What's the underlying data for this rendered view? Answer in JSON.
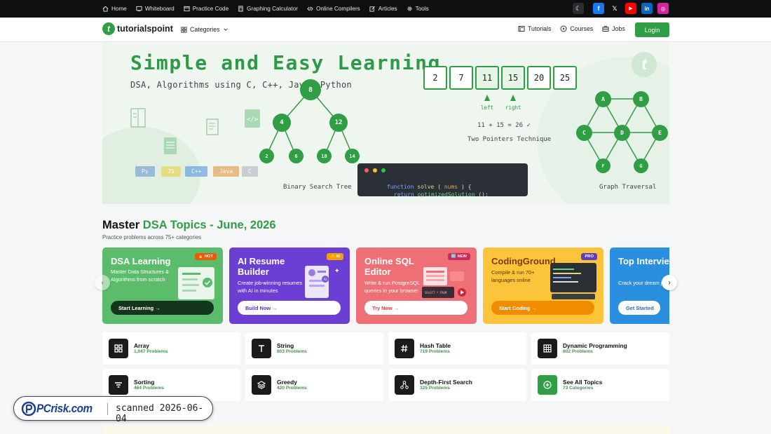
{
  "topnav": [
    {
      "label": "Home",
      "icon": "home-icon"
    },
    {
      "label": "Whiteboard",
      "icon": "whiteboard-icon"
    },
    {
      "label": "Practice Code",
      "icon": "code-window-icon"
    },
    {
      "label": "Graphing Calculator",
      "icon": "calculator-icon"
    },
    {
      "label": "Online Compilers",
      "icon": "code-brackets-icon"
    },
    {
      "label": "Articles",
      "icon": "pencil-icon"
    },
    {
      "label": "Tools",
      "icon": "gear-icon"
    }
  ],
  "header": {
    "logo_text": "tutorialspoint",
    "categories_label": "Categories",
    "links": [
      {
        "label": "Tutorials",
        "icon": "book-icon"
      },
      {
        "label": "Courses",
        "icon": "play-circle-icon"
      },
      {
        "label": "Jobs",
        "icon": "briefcase-icon"
      }
    ],
    "login_label": "Login"
  },
  "hero": {
    "title": "Simple and Easy Learning",
    "subtitle": "DSA, Algorithms using C, C++, Java, Python",
    "bst_nodes": [
      "8",
      "4",
      "12",
      "2",
      "6",
      "10",
      "14"
    ],
    "bst_caption": "Binary Search Tree",
    "langs": [
      "Py",
      "JS",
      "C++",
      "Java",
      "C"
    ],
    "array": [
      "2",
      "7",
      "11",
      "15",
      "20",
      "25"
    ],
    "left_label": "left",
    "right_label": "right",
    "sum_text": "11 + 15 = 26 ✓",
    "two_pointers_caption": "Two Pointers Technique",
    "graph_nodes": [
      "A",
      "B",
      "C",
      "D",
      "E",
      "F",
      "G"
    ],
    "graph_caption": "Graph Traversal",
    "code_line1": {
      "kw": "function",
      "fn": "solve",
      "open": "(",
      "arg": "nums",
      "close": ")",
      "brace": "{"
    },
    "code_line2": {
      "kw": "return",
      "fn": "optimizedSolution",
      "call": "();"
    }
  },
  "section": {
    "title_plain": "Master",
    "title_green": "DSA Topics - June, 2026",
    "subtitle": "Practice problems across 75+ categories"
  },
  "cards": [
    {
      "title": "DSA Learning",
      "desc": "Master Data Structures & Algorithms from scratch",
      "button": "Start Learning →",
      "badge": "🔥 HOT",
      "bg": "#5bbd6b",
      "btn_bg": "#14361d",
      "btn_color": "#ffffff",
      "badge_bg": "#e8590c"
    },
    {
      "title": "AI Resume Builder",
      "desc": "Create job-winning resumes with AI in minutes",
      "button": "Build Now →",
      "badge": "✨ AI",
      "bg": "#6b3fd4",
      "btn_bg": "#ffffff",
      "btn_color": "#5b2fc0",
      "badge_bg": "#f59f00"
    },
    {
      "title": "Online SQL Editor",
      "desc": "Write & run PostgreSQL queries in your browser",
      "button": "Try Now →",
      "badge": "🆕 NEW",
      "bg": "#ef6f77",
      "btn_bg": "#ffffff",
      "btn_color": "#e03a4a",
      "badge_bg": "#c92a5a"
    },
    {
      "title": "CodingGround",
      "desc": "Compile & run 70+ languages online",
      "button": "Start Coding →",
      "badge": "PRO",
      "bg": "#fcc43a",
      "btn_bg": "#f08c00",
      "btn_color": "#ffffff",
      "badge_bg": "#5f3dc4"
    },
    {
      "title": "Top Interview Questions",
      "desc": "Crack your dream job",
      "button": "Get Started",
      "badge": "",
      "bg": "#2b8fe0",
      "btn_bg": "#ffffff",
      "btn_color": "#1c6fc2",
      "badge_bg": "#2b8fe0"
    }
  ],
  "topics": [
    {
      "name": "Array",
      "count": "1,047 Problems",
      "icon": "grid-icon"
    },
    {
      "name": "String",
      "count": "803 Problems",
      "icon": "text-t-icon"
    },
    {
      "name": "Hash Table",
      "count": "719 Problems",
      "icon": "hash-icon"
    },
    {
      "name": "Dynamic Programming",
      "count": "602 Problems",
      "icon": "table-icon"
    },
    {
      "name": "Sorting",
      "count": "464 Problems",
      "icon": "sort-lines-icon"
    },
    {
      "name": "Greedy",
      "count": "420 Problems",
      "icon": "layers-icon"
    },
    {
      "name": "Depth-First Search",
      "count": "325 Problems",
      "icon": "graph-nodes-icon"
    },
    {
      "name": "See All Topics",
      "count": "73 Categories",
      "icon": "plus-circle-icon"
    }
  ],
  "watermark": {
    "brand": "PCrisk.com",
    "scanned": "scanned 2026-06-04"
  },
  "colors": {
    "brand_green": "#2f9e44",
    "topbar": "#0e0f11",
    "hero_bg": "#eef6ef"
  }
}
